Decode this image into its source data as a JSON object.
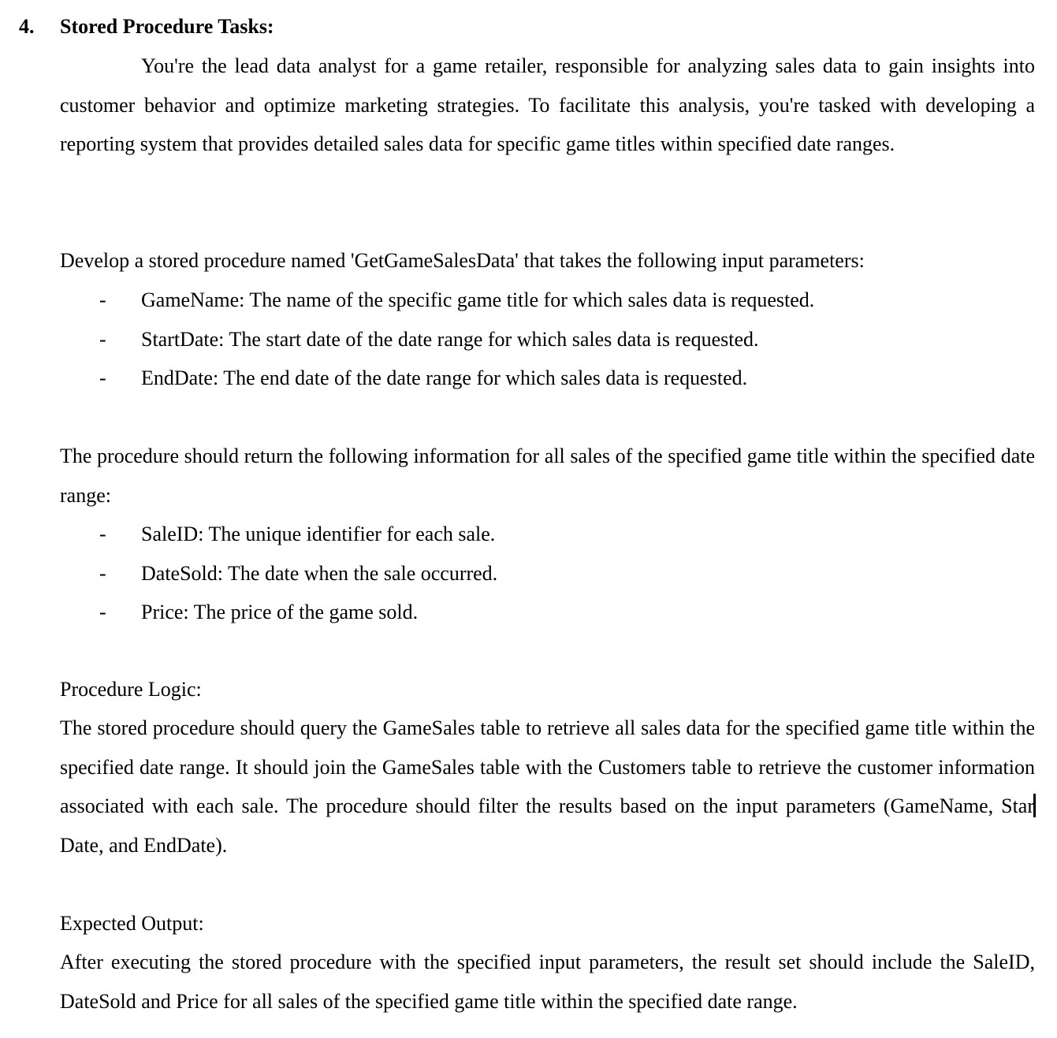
{
  "section": {
    "number": "4.",
    "title": "Stored Procedure Tasks:"
  },
  "intro": "You're the lead data analyst for a game retailer, responsible for analyzing sales data to gain insights into customer behavior and optimize marketing strategies. To facilitate this analysis, you're tasked with developing a reporting system that provides detailed sales data for specific game titles within specified date ranges.",
  "parameters": {
    "lead": "Develop a stored procedure named 'GetGameSalesData' that takes the following input parameters:",
    "items": [
      {
        "dash": "-",
        "text": "GameName: The name of the specific game title for which sales data is requested."
      },
      {
        "dash": "-",
        "text": "StartDate: The start date of the date range for which sales data is requested."
      },
      {
        "dash": "-",
        "text": "EndDate: The end date of the date range for which sales data is requested."
      }
    ]
  },
  "returns": {
    "lead": "The procedure should return the following information for all sales of the specified game title within the specified date range:",
    "items": [
      {
        "dash": "-",
        "text": "SaleID: The unique identifier for each sale."
      },
      {
        "dash": "-",
        "text": "DateSold: The date when the sale occurred."
      },
      {
        "dash": "-",
        "text": "Price: The price of the game sold."
      }
    ]
  },
  "logic": {
    "heading": "Procedure Logic:",
    "body_before_caret": "The stored procedure should query the GameSales table to retrieve all sales data for the specified game title within the specified date range. It should join the GameSales table with the Customers table to retrieve the customer information associated with each sale. The procedure should filter the results based on the input parameters (GameName, Star",
    "body_after_caret": "Date, and EndDate)."
  },
  "output": {
    "heading": "Expected Output:",
    "body": "After executing the stored procedure with the specified input parameters, the result set should include the SaleID, DateSold and Price for all sales of the specified game title within the specified date range."
  }
}
